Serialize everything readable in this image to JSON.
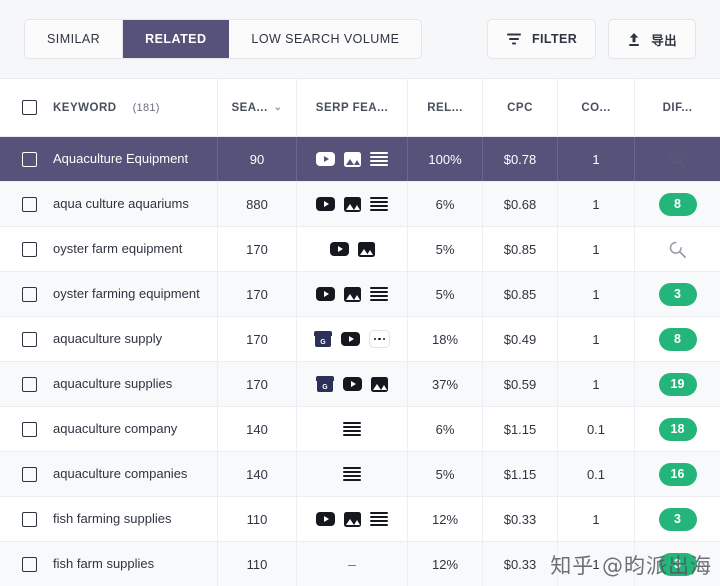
{
  "toolbar": {
    "tabs": [
      {
        "label": "SIMILAR",
        "active": false
      },
      {
        "label": "RELATED",
        "active": true
      },
      {
        "label": "LOW SEARCH VOLUME",
        "active": false
      }
    ],
    "filter_label": "FILTER",
    "export_label": "导出"
  },
  "table": {
    "headers": {
      "keyword": "KEYWORD",
      "keyword_count": "(181)",
      "volume": "SEA...",
      "serp": "SERP FEA...",
      "relevance": "REL...",
      "cpc": "CPC",
      "competition": "CO...",
      "difficulty": "DIF..."
    },
    "sort_caret": "⌄",
    "rows": [
      {
        "keyword": "Aquaculture Equipment",
        "volume": "90",
        "serp": [
          "video-icon",
          "image-icon",
          "lines-icon"
        ],
        "relevance": "100%",
        "cpc": "$0.78",
        "competition": "1",
        "difficulty": "",
        "difficulty_state": "loading",
        "selected": true
      },
      {
        "keyword": "aqua culture aquariums",
        "volume": "880",
        "serp": [
          "video-icon",
          "image-icon",
          "lines-icon"
        ],
        "relevance": "6%",
        "cpc": "$0.68",
        "competition": "1",
        "difficulty": "8",
        "difficulty_state": "value",
        "selected": false
      },
      {
        "keyword": "oyster farm equipment",
        "volume": "170",
        "serp": [
          "video-icon",
          "image-icon"
        ],
        "relevance": "5%",
        "cpc": "$0.85",
        "competition": "1",
        "difficulty": "",
        "difficulty_state": "loading",
        "selected": false
      },
      {
        "keyword": "oyster farming equipment",
        "volume": "170",
        "serp": [
          "video-icon",
          "image-icon",
          "lines-icon"
        ],
        "relevance": "5%",
        "cpc": "$0.85",
        "competition": "1",
        "difficulty": "3",
        "difficulty_state": "value",
        "selected": false
      },
      {
        "keyword": "aquaculture supply",
        "volume": "170",
        "serp": [
          "shop-icon",
          "video-icon",
          "more-icon"
        ],
        "relevance": "18%",
        "cpc": "$0.49",
        "competition": "1",
        "difficulty": "8",
        "difficulty_state": "value",
        "selected": false
      },
      {
        "keyword": "aquaculture supplies",
        "volume": "170",
        "serp": [
          "shop-icon",
          "video-icon",
          "image-icon"
        ],
        "relevance": "37%",
        "cpc": "$0.59",
        "competition": "1",
        "difficulty": "19",
        "difficulty_state": "value",
        "selected": false
      },
      {
        "keyword": "aquaculture company",
        "volume": "140",
        "serp": [
          "lines-icon"
        ],
        "relevance": "6%",
        "cpc": "$1.15",
        "competition": "0.1",
        "difficulty": "18",
        "difficulty_state": "value",
        "selected": false
      },
      {
        "keyword": "aquaculture companies",
        "volume": "140",
        "serp": [
          "lines-icon"
        ],
        "relevance": "5%",
        "cpc": "$1.15",
        "competition": "0.1",
        "difficulty": "16",
        "difficulty_state": "value",
        "selected": false
      },
      {
        "keyword": "fish farming supplies",
        "volume": "110",
        "serp": [
          "video-icon",
          "image-icon",
          "lines-icon"
        ],
        "relevance": "12%",
        "cpc": "$0.33",
        "competition": "1",
        "difficulty": "3",
        "difficulty_state": "value",
        "selected": false
      },
      {
        "keyword": "fish farm supplies",
        "volume": "110",
        "serp": [
          "dash"
        ],
        "relevance": "12%",
        "cpc": "$0.33",
        "competition": "1",
        "difficulty": "3",
        "difficulty_state": "value",
        "selected": false
      }
    ]
  },
  "watermark": {
    "text": "知乎 @昀派出海"
  },
  "colors": {
    "accent_purple": "#56527a",
    "badge_green": "#23b57a",
    "text_dark": "#2f3441",
    "row_alt": "#f8f9fa",
    "page_bg": "#f6f7f9"
  }
}
